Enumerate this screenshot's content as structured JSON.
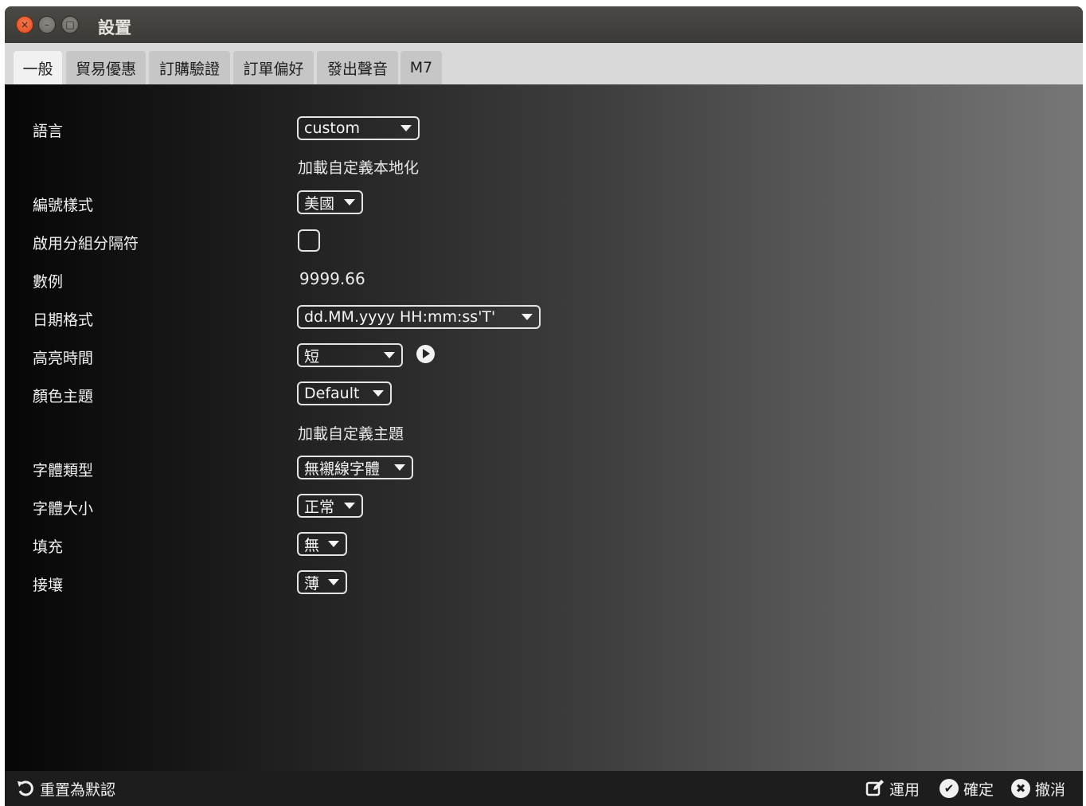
{
  "window": {
    "title": "設置",
    "controls": {
      "close": "×",
      "minimize": "–",
      "maximize": "□"
    }
  },
  "tabs": [
    {
      "label": "一般",
      "active": true
    },
    {
      "label": "貿易優惠",
      "active": false
    },
    {
      "label": "訂購驗證",
      "active": false
    },
    {
      "label": "訂單偏好",
      "active": false
    },
    {
      "label": "發出聲音",
      "active": false
    },
    {
      "label": "M7",
      "active": false
    }
  ],
  "settings": {
    "language": {
      "label": "語言",
      "value": "custom",
      "link": "加載自定義本地化"
    },
    "number_format": {
      "label": "編號樣式",
      "value": "美國"
    },
    "grouping": {
      "label": "啟用分組分隔符",
      "checked": false
    },
    "example": {
      "label": "數例",
      "value": "9999.66"
    },
    "date_format": {
      "label": "日期格式",
      "value": "dd.MM.yyyy HH:mm:ss'T'"
    },
    "highlight_time": {
      "label": "高亮時間",
      "value": "短"
    },
    "color_theme": {
      "label": "顏色主題",
      "value": "Default",
      "link": "加載自定義主題"
    },
    "font_type": {
      "label": "字體類型",
      "value": "無襯線字體"
    },
    "font_size": {
      "label": "字體大小",
      "value": "正常"
    },
    "padding": {
      "label": "填充",
      "value": "無"
    },
    "border": {
      "label": "接壤",
      "value": "薄"
    }
  },
  "footer": {
    "reset": "重置為默認",
    "apply": "運用",
    "ok": "確定",
    "cancel": "撤消"
  },
  "icons": {
    "reset": "undo-icon",
    "apply": "edit-icon",
    "ok": "check-circle-icon",
    "cancel": "x-circle-icon",
    "check_glyph": "✔",
    "x_glyph": "✖"
  }
}
